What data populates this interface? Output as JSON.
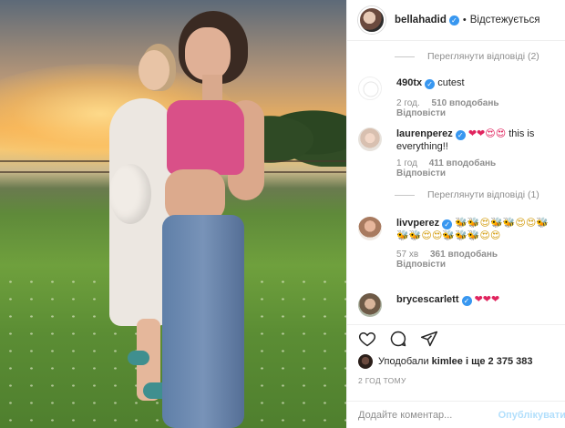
{
  "post": {
    "image_alt": "",
    "author": {
      "username": "bellahadid",
      "verified": true,
      "follow_status": "Відстежується"
    }
  },
  "comments": [
    {
      "type": "view_replies",
      "label": "Переглянути відповіді (2)"
    },
    {
      "type": "comment",
      "username": "490tx",
      "verified": true,
      "text": "cutest",
      "time": "2 год.",
      "likes": "510 вподобань",
      "reply": "Відповісти"
    },
    {
      "type": "comment",
      "username": "laurenperez",
      "verified": true,
      "emoji": "❤❤😍😍",
      "text": "this is everything!!",
      "time": "1 год",
      "likes": "411 вподобань",
      "reply": "Відповісти"
    },
    {
      "type": "view_replies",
      "label": "Переглянути відповіді (1)"
    },
    {
      "type": "comment",
      "username": "livvperez",
      "verified": true,
      "emoji": "🐝🐝😍🐝🐝😍😍🐝🐝🐝😍😍🐝🐝🐝😍😍",
      "text": "",
      "time": "57 хв",
      "likes": "361 вподобань",
      "reply": "Відповісти"
    },
    {
      "type": "comment",
      "username": "brycescarlett",
      "verified": true,
      "emoji": "❤❤❤",
      "text": ""
    }
  ],
  "actions": {
    "like_icon": "heart-icon",
    "comment_icon": "comment-icon",
    "share_icon": "share-icon"
  },
  "likes_summary": {
    "prefix": "Уподобали",
    "user": "kimlee",
    "suffix": "і ще 2 375 383"
  },
  "time_ago": "2 ГОД ТОМУ",
  "add_comment": {
    "placeholder": "Додайте коментар...",
    "publish_label": "Опублікувати"
  },
  "colors": {
    "verified": "#3897f0",
    "accent_pink": "#d95088",
    "publish_disabled": "#b2dffc"
  }
}
